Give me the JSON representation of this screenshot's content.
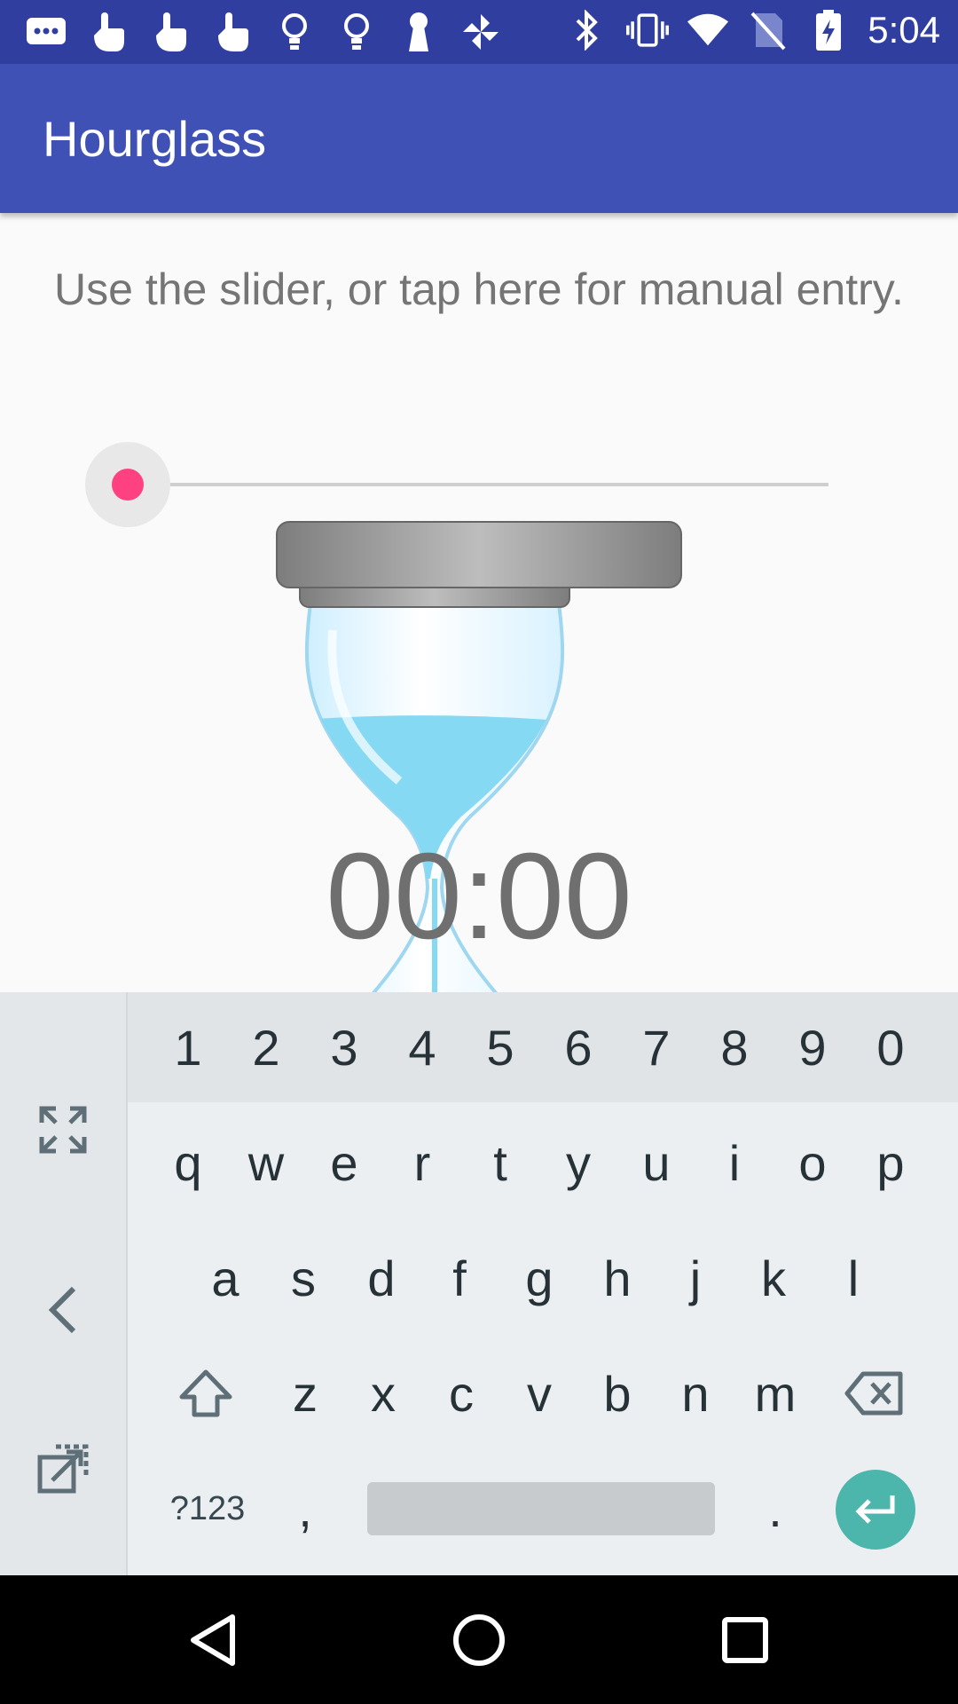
{
  "status_bar": {
    "time": "5:04",
    "left_icons": [
      "message-icon",
      "touch-icon",
      "touch-icon",
      "touch-icon",
      "bulb-icon",
      "bulb-icon",
      "keyhole-icon",
      "pinwheel-icon"
    ],
    "right_icons": [
      "bluetooth-icon",
      "vibrate-icon",
      "wifi-icon",
      "no-sim-icon",
      "battery-charging-icon"
    ]
  },
  "app_bar": {
    "title": "Hourglass"
  },
  "hint": "Use the slider, or tap here for manual entry.",
  "slider": {
    "value": 0
  },
  "timer": {
    "display": "00:00"
  },
  "keyboard": {
    "number_row": [
      "1",
      "2",
      "3",
      "4",
      "5",
      "6",
      "7",
      "8",
      "9",
      "0"
    ],
    "row1": [
      "q",
      "w",
      "e",
      "r",
      "t",
      "y",
      "u",
      "i",
      "o",
      "p"
    ],
    "row2": [
      "a",
      "s",
      "d",
      "f",
      "g",
      "h",
      "j",
      "k",
      "l"
    ],
    "row3": [
      "z",
      "x",
      "c",
      "v",
      "b",
      "n",
      "m"
    ],
    "symbols_label": "?123",
    "comma": ",",
    "period": ".",
    "side_icons": [
      "expand-icon",
      "chevron-left-icon",
      "popout-icon"
    ]
  },
  "nav_bar": {
    "icons": [
      "back-icon",
      "home-icon",
      "recents-icon"
    ]
  },
  "colors": {
    "status_bar": "#303f9f",
    "app_bar": "#3f51b5",
    "accent": "#ff4081",
    "enter_key": "#4db6ac"
  }
}
